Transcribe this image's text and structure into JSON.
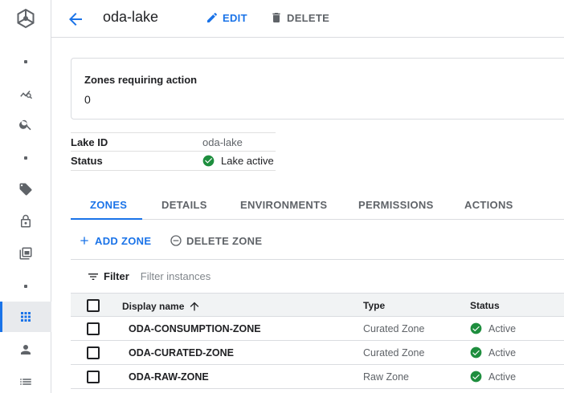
{
  "header": {
    "title": "oda-lake",
    "edit_label": "EDIT",
    "delete_label": "DELETE"
  },
  "summary": {
    "label": "Zones requiring action",
    "value": "0"
  },
  "info": {
    "rows": [
      {
        "key": "Lake ID",
        "value": "oda-lake"
      },
      {
        "key": "Status",
        "value": "Lake active"
      }
    ]
  },
  "tabs": [
    {
      "label": "ZONES",
      "active": true
    },
    {
      "label": "DETAILS"
    },
    {
      "label": "ENVIRONMENTS"
    },
    {
      "label": "PERMISSIONS"
    },
    {
      "label": "ACTIONS"
    }
  ],
  "actions": {
    "add_label": "ADD ZONE",
    "delete_label": "DELETE ZONE"
  },
  "filter": {
    "label": "Filter",
    "placeholder": "Filter instances"
  },
  "table": {
    "headers": {
      "name": "Display name",
      "type": "Type",
      "status": "Status"
    },
    "rows": [
      {
        "name": "ODA-CONSUMPTION-ZONE",
        "type": "Curated Zone",
        "status": "Active"
      },
      {
        "name": "ODA-CURATED-ZONE",
        "type": "Curated Zone",
        "status": "Active"
      },
      {
        "name": "ODA-RAW-ZONE",
        "type": "Raw Zone",
        "status": "Active"
      }
    ]
  },
  "colors": {
    "accent": "#1a73e8",
    "success": "#1e8e3e",
    "text": "#202124",
    "muted": "#5f6368"
  },
  "icons": {
    "rail": [
      "dataplex-logo",
      "dot",
      "explore-chart-icon",
      "search-icon",
      "dot",
      "tag-icon",
      "lock-icon",
      "copy-icon",
      "dot",
      "grid-icon",
      "person-icon",
      "list-icon"
    ]
  }
}
